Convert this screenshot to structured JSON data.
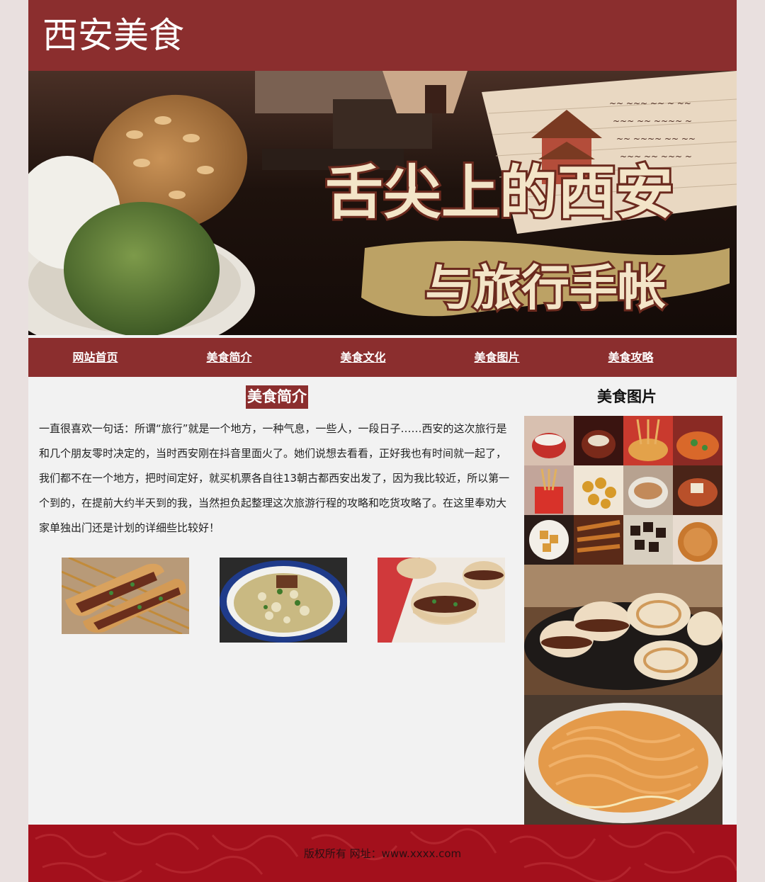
{
  "header": {
    "site_title": "西安美食"
  },
  "banner": {
    "headline": "舌尖上的西安",
    "subline": "与旅行手帐"
  },
  "nav": {
    "items": [
      {
        "label": "网站首页"
      },
      {
        "label": "美食简介"
      },
      {
        "label": "美食文化"
      },
      {
        "label": "美食图片"
      },
      {
        "label": "美食攻略"
      }
    ]
  },
  "intro": {
    "heading": "美食简介",
    "body": "一直很喜欢一句话：所谓“旅行”就是一个地方，一种气息，一些人，一段日子……西安的这次旅行是和几个朋友零时决定的，当时西安刚在抖音里面火了。她们说想去看看，正好我也有时间就一起了，我们都不在一个地方，把时间定好，就买机票各自往13朝古都西安出发了，因为我比较近，所以第一个到的，在提前大约半天到的我，当然担负起整理这次旅游行程的攻略和吃货攻略了。在这里奉劝大家单独出门还是计划的详细些比较好！"
  },
  "gallery": {
    "heading": "美食图片"
  },
  "footer": {
    "text": "版权所有 网址：www.xxxx.com"
  },
  "colors": {
    "brand": "#8b2e2e",
    "footer": "#a3101c",
    "page_bg": "#e9e0df",
    "content_bg": "#f2f2f2"
  }
}
